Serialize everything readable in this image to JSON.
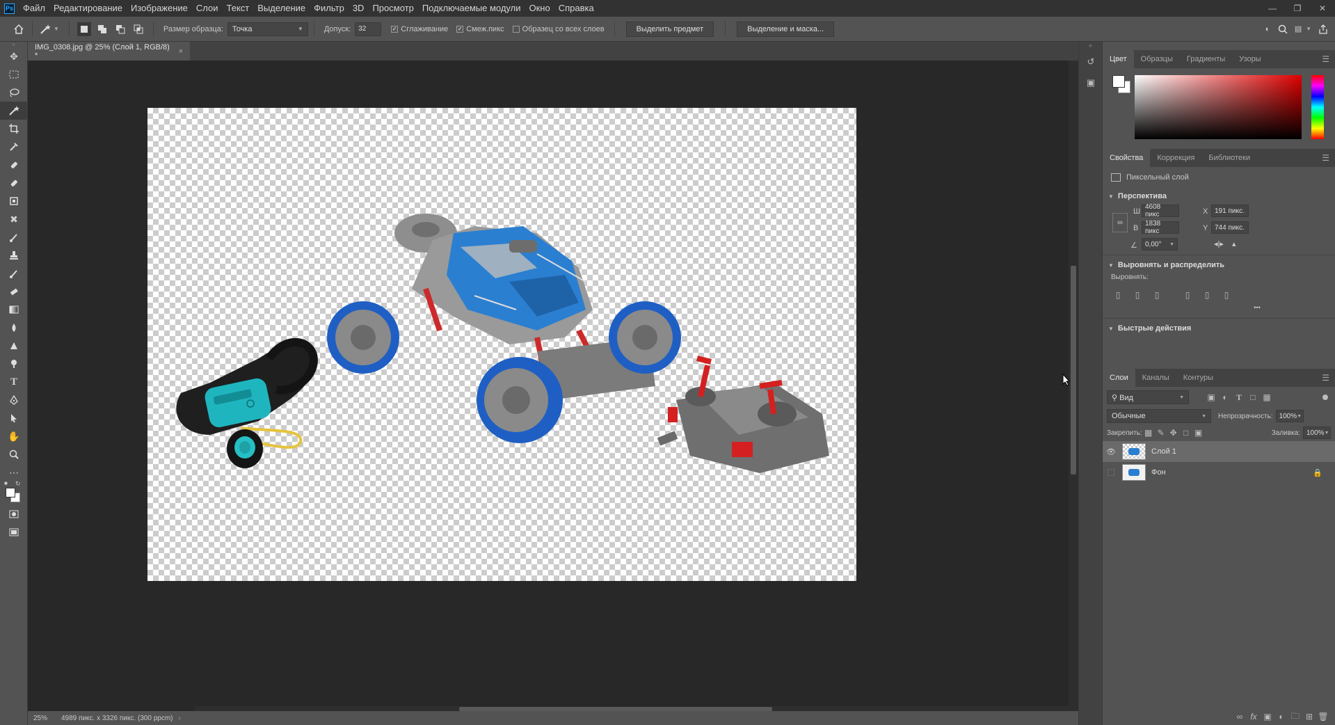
{
  "app": {
    "logo": "Ps"
  },
  "menu": [
    "Файл",
    "Редактирование",
    "Изображение",
    "Слои",
    "Текст",
    "Выделение",
    "Фильтр",
    "3D",
    "Просмотр",
    "Подключаемые модули",
    "Окно",
    "Справка"
  ],
  "options": {
    "sample_size_label": "Размер образца:",
    "sample_size_value": "Точка",
    "tolerance_label": "Допуск:",
    "tolerance_value": "32",
    "antialias_label": "Сглаживание",
    "contiguous_label": "Смеж.пикс",
    "all_layers_label": "Образец со всех слоев",
    "select_subject_label": "Выделить предмет",
    "select_mask_label": "Выделение и маска..."
  },
  "document": {
    "tab_title": "IMG_0308.jpg @ 25% (Слой 1, RGB/8) *",
    "close_glyph": "×",
    "zoom": "25%",
    "info": "4989 пикс. x 3326 пикс. (300 ppcm)"
  },
  "color_panel": {
    "tabs": [
      "Цвет",
      "Образцы",
      "Градиенты",
      "Узоры"
    ],
    "active": 0
  },
  "properties_panel": {
    "tabs": [
      "Свойства",
      "Коррекция",
      "Библиотеки"
    ],
    "layer_type": "Пиксельный слой",
    "transform_title": "Перспектива",
    "w_label": "Ш",
    "w_value": "4608 пикс",
    "h_label": "В",
    "h_value": "1838 пикс",
    "x_label": "X",
    "x_value": "191 пикс.",
    "y_label": "Y",
    "y_value": "744 пикс.",
    "angle_value": "0,00°",
    "align_title": "Выровнять и распределить",
    "align_label": "Выровнять:",
    "more_glyph": "•••",
    "quick_title": "Быстрые действия"
  },
  "layers_panel": {
    "tabs": [
      "Слои",
      "Каналы",
      "Контуры"
    ],
    "filter_value": "Вид",
    "blend_mode": "Обычные",
    "opacity_label": "Непрозрачность:",
    "opacity_value": "100%",
    "lock_label": "Закрепить:",
    "fill_label": "Заливка:",
    "fill_value": "100%",
    "layers": [
      {
        "name": "Слой 1",
        "visible": true,
        "selected": true
      },
      {
        "name": "Фон",
        "visible": false,
        "locked": true
      }
    ]
  },
  "colors": {
    "accent": "#31a8ff",
    "canvas_bg": "#282828",
    "panel_bg": "#535353"
  }
}
